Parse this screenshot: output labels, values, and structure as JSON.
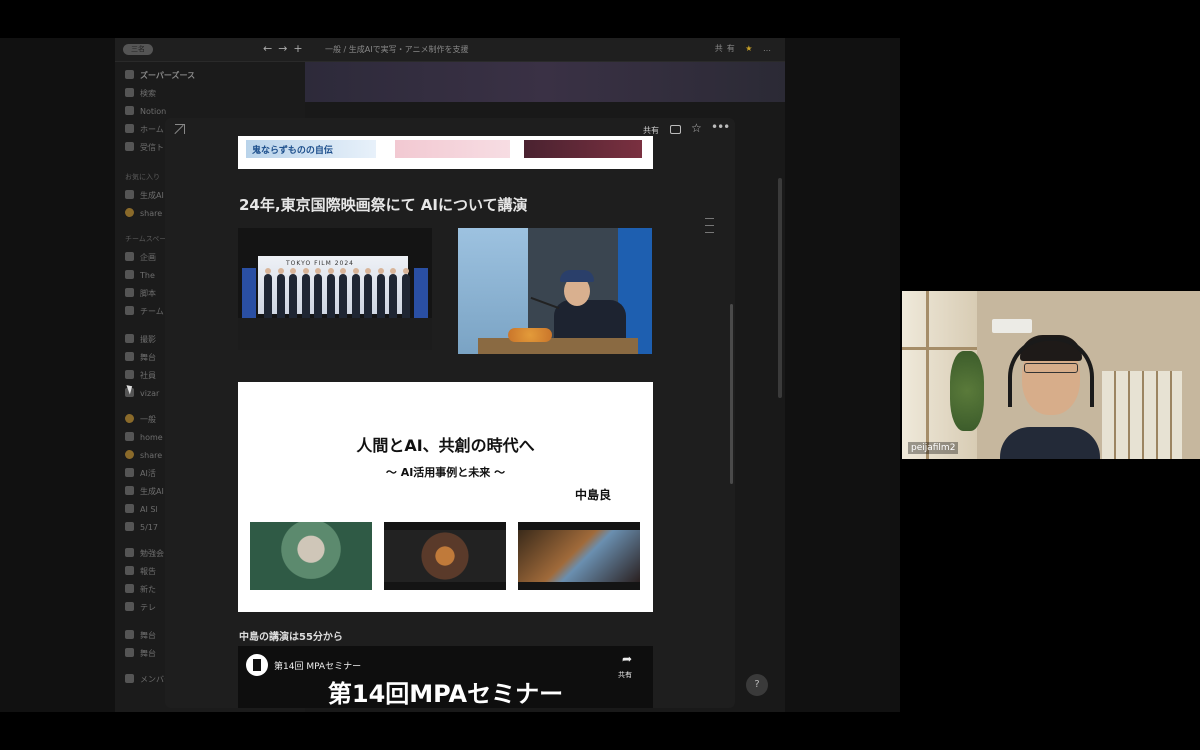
{
  "bg_app": {
    "pill_label": "三名",
    "crumb": "一般 / 生成AIで実写・アニメ制作を支援",
    "top_right": [
      "共有",
      "…"
    ],
    "sidebar": [
      {
        "text": "ズーパーズース",
        "kind": "ws"
      },
      {
        "text": "検索",
        "kind": "item"
      },
      {
        "text": "Notion",
        "kind": "item"
      },
      {
        "text": "ホーム",
        "kind": "item"
      },
      {
        "text": "受信トレイ",
        "kind": "item"
      },
      {
        "text": "お気に入り",
        "kind": "head"
      },
      {
        "text": "生成AI",
        "kind": "item"
      },
      {
        "text": "share",
        "kind": "item"
      },
      {
        "text": "チームスペース",
        "kind": "head"
      },
      {
        "text": "企画",
        "kind": "item"
      },
      {
        "text": "The",
        "kind": "item"
      },
      {
        "text": "脚本",
        "kind": "item"
      },
      {
        "text": "チーム",
        "kind": "item"
      },
      {
        "text": "撮影",
        "kind": "item"
      },
      {
        "text": "舞台",
        "kind": "item"
      },
      {
        "text": "社員",
        "kind": "item"
      },
      {
        "text": "vizar",
        "kind": "item"
      },
      {
        "text": "一般",
        "kind": "item"
      },
      {
        "text": "home",
        "kind": "item"
      },
      {
        "text": "share",
        "kind": "item"
      },
      {
        "text": "AI活",
        "kind": "item"
      },
      {
        "text": "生成AI",
        "kind": "item"
      },
      {
        "text": "AI Sl",
        "kind": "item"
      },
      {
        "text": "5/17",
        "kind": "item"
      },
      {
        "text": "勉強会",
        "kind": "item"
      },
      {
        "text": "報告",
        "kind": "item"
      },
      {
        "text": "新た",
        "kind": "item"
      },
      {
        "text": "テレ",
        "kind": "item"
      },
      {
        "text": "舞台",
        "kind": "item"
      },
      {
        "text": "舞台",
        "kind": "item"
      },
      {
        "text": "メンバーを招待",
        "kind": "item"
      }
    ]
  },
  "modal": {
    "share_label": "共有",
    "top_card_thumb1": "鬼ならずものの自伝",
    "heading": "24年,東京国際映画祭にて AIについて講演",
    "photo1_sign": "TOKYO FILM 2024",
    "slide": {
      "title": "人間とAI、共創の時代へ",
      "subtitle": "〜 AI活用事例と未来 〜",
      "author": "中島良"
    },
    "lecture_note": "中島の講演は55分から",
    "video": {
      "label": "第14回 MPAセミナー",
      "big_title": "第14回MPAセミナー",
      "share_label": "共有"
    }
  },
  "participant": {
    "name": "peijafilm2"
  },
  "icons": {
    "help": "question-icon"
  }
}
